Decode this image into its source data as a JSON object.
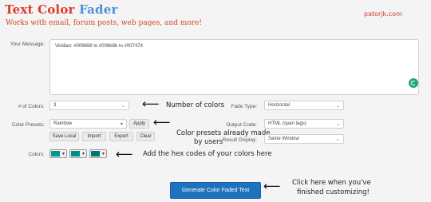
{
  "brand": {
    "title_part1": "Text Color",
    "title_part2": "Fader",
    "subtitle": "Works with email, forum posts, web pages, and more!",
    "site": "patorjk.com"
  },
  "message": {
    "label": "Your Message:",
    "value": "Viridian: #009698 to #008b8b to #007474"
  },
  "num_colors": {
    "label": "# of Colors:",
    "value": "3"
  },
  "fade_type": {
    "label": "Fade Type:",
    "value": "Horizontal"
  },
  "presets": {
    "label": "Color Presets:",
    "value": "Rainbow",
    "apply": "Apply",
    "save_local": "Save Local",
    "import": "Import",
    "export": "Export",
    "clear": "Clear"
  },
  "output_code": {
    "label": "Output Code:",
    "value": "HTML (span tags)"
  },
  "result_display": {
    "label": "Result Display:",
    "value": "Same Window"
  },
  "colors": {
    "label": "Colors:",
    "swatches": [
      "#009698",
      "#008b8b",
      "#007474"
    ]
  },
  "generate_button": "Generate Color Faded Text",
  "annotations": {
    "num_colors": "Number of colors",
    "presets_line1": "Color presets already made",
    "presets_line2": "by users",
    "colors": "Add the hex codes of your colors here",
    "generate_line1": "Click here when you've",
    "generate_line2": "finished customizing!"
  },
  "icons": {
    "arrow": "left-arrow-icon",
    "chevron": "chevron-down-icon",
    "grammarly": "grammarly-icon"
  }
}
